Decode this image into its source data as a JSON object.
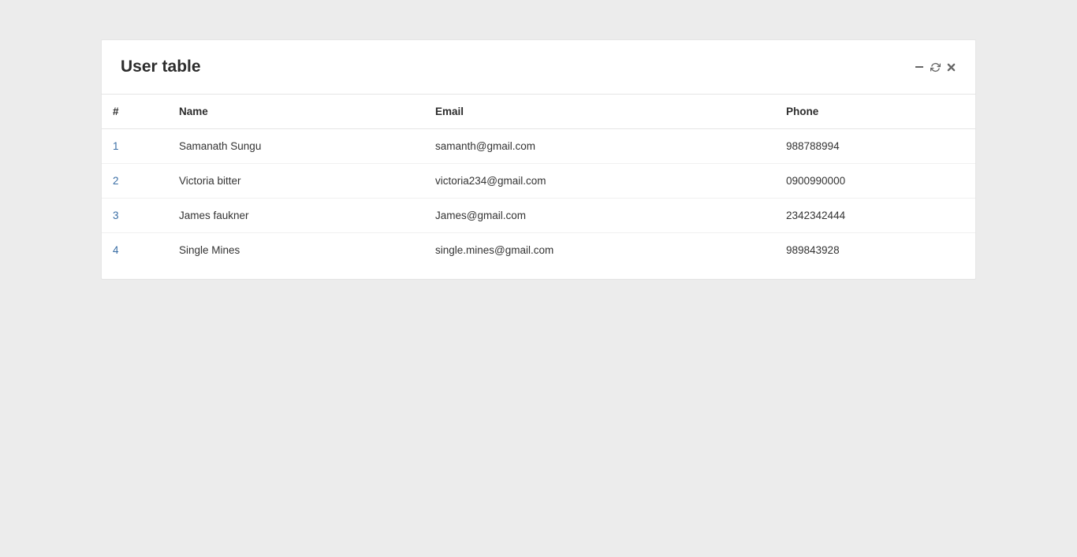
{
  "panel": {
    "title": "User table"
  },
  "table": {
    "headers": {
      "index": "#",
      "name": "Name",
      "email": "Email",
      "phone": "Phone"
    },
    "rows": [
      {
        "index": "1",
        "name": "Samanath Sungu",
        "email": "samanth@gmail.com",
        "phone": "988788994"
      },
      {
        "index": "2",
        "name": "Victoria bitter",
        "email": "victoria234@gmail.com",
        "phone": "0900990000"
      },
      {
        "index": "3",
        "name": "James faukner",
        "email": "James@gmail.com",
        "phone": "2342342444"
      },
      {
        "index": "4",
        "name": "Single Mines",
        "email": "single.mines@gmail.com",
        "phone": "989843928"
      }
    ]
  }
}
